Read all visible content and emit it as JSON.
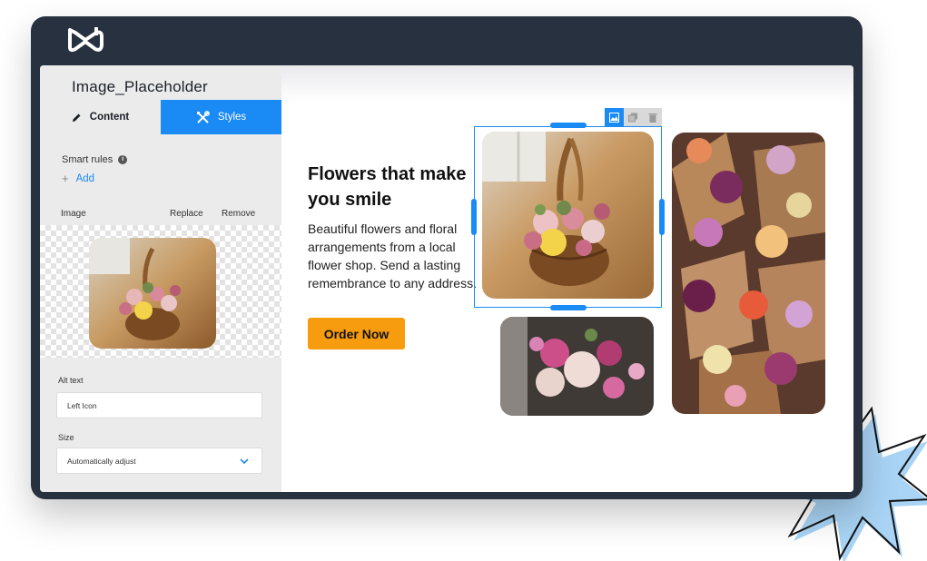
{
  "panel": {
    "title": "Image_Placeholder",
    "tabs": [
      {
        "label": "Content",
        "icon": "pencil-icon",
        "active": false
      },
      {
        "label": "Styles",
        "icon": "tools-icon",
        "active": true
      }
    ],
    "smart_rules_label": "Smart rules",
    "add_label": "Add",
    "image_label": "Image",
    "replace_label": "Replace",
    "remove_label": "Remove",
    "alt_text_label": "Alt text",
    "alt_text_value": "Left Icon",
    "size_label": "Size",
    "size_value": "Automatically adjust"
  },
  "canvas": {
    "headline": "Flowers that make you smile",
    "body": "Beautiful flowers and floral arrangements from a local flower shop. Send a lasting remembrance to any address.",
    "cta_label": "Order Now",
    "toolbar_icons": [
      "image-icon",
      "duplicate-icon",
      "trash-icon"
    ]
  },
  "colors": {
    "accent": "#1a8af5",
    "cta": "#f79c0e",
    "window": "#27313f",
    "panel": "#ebebeb",
    "burst": "#a9d4f5"
  }
}
